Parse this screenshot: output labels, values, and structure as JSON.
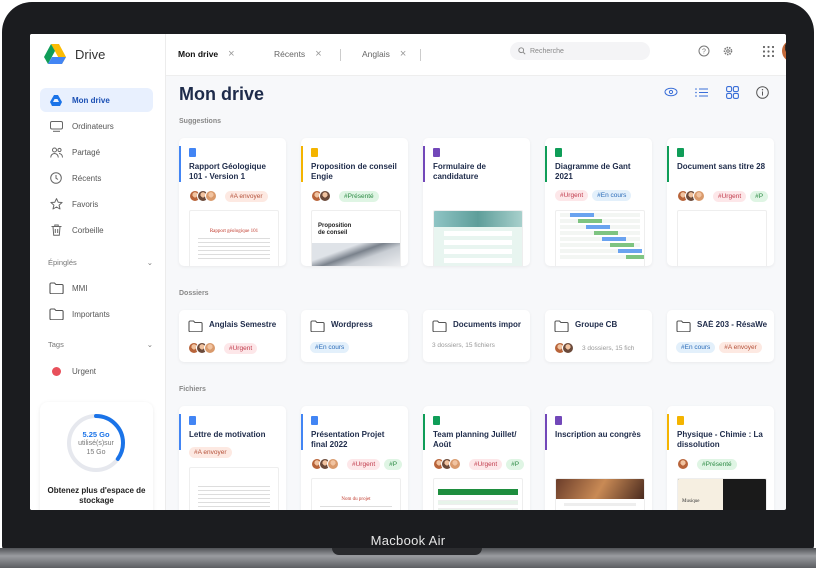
{
  "device": {
    "label": "Macbook Air"
  },
  "app": {
    "name": "Drive"
  },
  "tabs": [
    {
      "label": "Mon drive",
      "active": true
    },
    {
      "label": "Récents"
    },
    {
      "label": "Anglais"
    }
  ],
  "search": {
    "placeholder": "Recherche"
  },
  "sidebar": {
    "items": [
      {
        "label": "Mon drive",
        "icon": "drive-icon",
        "active": true
      },
      {
        "label": "Ordinateurs",
        "icon": "computer-icon"
      },
      {
        "label": "Partagé",
        "icon": "people-icon"
      },
      {
        "label": "Récents",
        "icon": "clock-icon"
      },
      {
        "label": "Favoris",
        "icon": "star-icon"
      },
      {
        "label": "Corbeille",
        "icon": "trash-icon"
      }
    ],
    "pinned_header": "Épinglés",
    "pinned": [
      {
        "label": "MMI"
      },
      {
        "label": "Importants"
      }
    ],
    "tags_header": "Tags",
    "tags": [
      {
        "label": "Urgent",
        "color": "#e8505b"
      }
    ]
  },
  "storage": {
    "used": "5.25 Go",
    "line2": "utilisé(s)sur",
    "total": "15 Go",
    "fraction": 0.35,
    "cta": "Obtenez plus d'espace de stockage"
  },
  "main": {
    "title": "Mon drive",
    "sections": {
      "suggestions": "Suggestions",
      "folders": "Dossiers",
      "files": "Fichiers"
    }
  },
  "suggestions": [
    {
      "title": "Rapport Géologique 101 - Version 1",
      "kind": "doc",
      "color": "#4285f4",
      "tags": [
        "#A envoyer"
      ],
      "avatars": 3,
      "preview_title": "Rapport géologique 101"
    },
    {
      "title": "Proposition de conseil Engie",
      "kind": "slides",
      "color": "#f4b400",
      "tags": [
        "#Présenté"
      ],
      "avatars": 2,
      "preview_title": "Proposition de conseil"
    },
    {
      "title": "Formulaire de candidature",
      "kind": "form",
      "color": "#7248b9",
      "tags": [],
      "avatars": 0,
      "preview_title": ""
    },
    {
      "title": "Diagramme de Gant 2021",
      "kind": "sheet",
      "color": "#0f9d58",
      "tags": [
        "#Urgent",
        "#En cours"
      ],
      "avatars": 0,
      "preview_title": ""
    },
    {
      "title": "Document sans titre 28",
      "kind": "sheet",
      "color": "#0f9d58",
      "tags": [
        "#Urgent",
        "#P"
      ],
      "avatars": 3,
      "preview_title": ""
    }
  ],
  "folders": [
    {
      "name": "Anglais Semestre",
      "avatars": 3,
      "tags": [
        "#Urgent"
      ],
      "meta": ""
    },
    {
      "name": "Wordpress",
      "avatars": 0,
      "tags": [
        "#En cours"
      ],
      "meta": ""
    },
    {
      "name": "Documents impor",
      "avatars": 0,
      "tags": [],
      "meta": "3 dossiers, 15 fichiers"
    },
    {
      "name": "Groupe CB",
      "avatars": 2,
      "tags": [],
      "meta": "3 dossiers, 15 fich"
    },
    {
      "name": "SAÉ 203 - RésaWe",
      "avatars": 0,
      "tags": [
        "#En cours",
        "#A envoyer"
      ],
      "meta": ""
    }
  ],
  "files": [
    {
      "title": "Lettre de motivation",
      "kind": "doc",
      "color": "#4285f4",
      "tags": [
        "#A envoyer"
      ],
      "avatars": 0
    },
    {
      "title": "Présentation Projet final 2022",
      "kind": "doc",
      "color": "#4285f4",
      "tags": [
        "#Urgent",
        "#P"
      ],
      "avatars": 3,
      "preview_title": "Nom du projet"
    },
    {
      "title": "Team planning Juillet/ Août",
      "kind": "sheet",
      "color": "#0f9d58",
      "tags": [
        "#Urgent",
        "#P"
      ],
      "avatars": 3
    },
    {
      "title": "Inscription au congrès",
      "kind": "form",
      "color": "#7248b9",
      "tags": [],
      "avatars": 0
    },
    {
      "title": "Physique - Chimie : La dissolution",
      "kind": "slides",
      "color": "#f4b400",
      "tags": [
        "#Présenté"
      ],
      "avatars": 1,
      "preview_title": "Musique"
    }
  ],
  "colors": {
    "accent": "#1a73e8",
    "title": "#1e2b4a",
    "active_nav_bg": "#e8f0fe"
  }
}
